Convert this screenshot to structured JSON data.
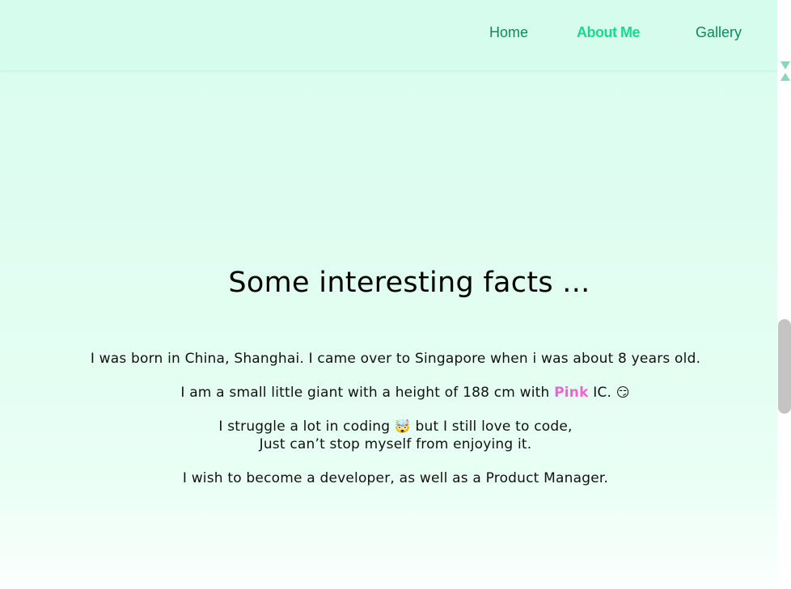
{
  "nav": {
    "home": "Home",
    "about": "About Me",
    "gallery": "Gallery"
  },
  "main": {
    "heading": "Some interesting facts ...",
    "fact1": "I was born in China, Shanghai. I came over to Singapore when i was about 8 years old.",
    "fact2_before": "I am a small little giant with a height of 188 cm with ",
    "fact2_pink": "Pink",
    "fact2_after": " IC. ",
    "fact2_emoji": "😏",
    "fact3_before": "I struggle a lot in coding ",
    "fact3_emoji": "🤯",
    "fact3_after": " but I still love to code,",
    "fact3_line2": "Just can’t stop myself from enjoying it.",
    "fact4": "I wish to become a developer, as well as a Product Manager."
  },
  "colors": {
    "navbar_bg": "#d6fced",
    "nav_text": "#0c8a5e",
    "nav_active": "#19d98e",
    "pink": "#f062d4",
    "scroll_arrow": "#88d7b9"
  },
  "icons": {
    "scroll_down": "triangle-down-icon",
    "scroll_up": "triangle-up-icon"
  }
}
